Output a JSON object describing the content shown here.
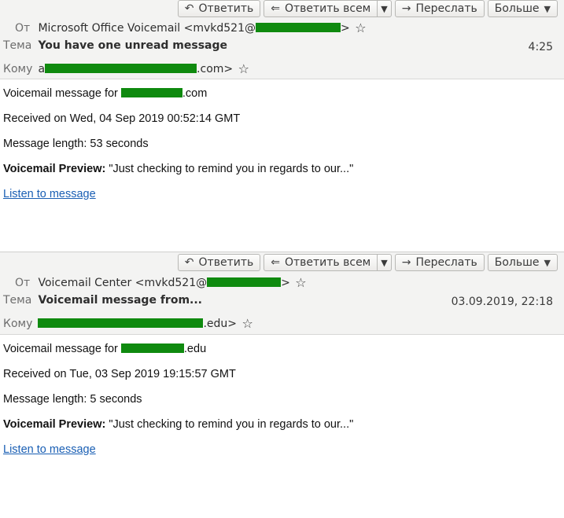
{
  "toolbar": {
    "reply_label": "Ответить",
    "reply_all_label": "Ответить всем",
    "forward_label": "Переслать",
    "more_label": "Больше"
  },
  "labels": {
    "from": "От",
    "subject": "Тема",
    "to": "Кому"
  },
  "emails": [
    {
      "from_text": "Microsoft Office Voicemail <mvkd521@",
      "from_suffix": ">",
      "subject": "You have one unread message",
      "date": "4:25",
      "to_prefix": "a",
      "to_suffix": ".com>",
      "body": {
        "line1_prefix": "Voicemail message for ",
        "line1_suffix": ".com",
        "received": "Received on Wed, 04 Sep 2019 00:52:14 GMT",
        "length": "Message length: 53 seconds",
        "preview_label": "Voicemail Preview:",
        "preview_text": " \"Just checking to remind you in regards to our...\"",
        "link": "Listen to message"
      }
    },
    {
      "from_text": "Voicemail Center <mvkd521@",
      "from_suffix": ">",
      "subject": "Voicemail message from...",
      "date": "03.09.2019, 22:18",
      "to_prefix": "",
      "to_suffix": ".edu>",
      "body": {
        "line1_prefix": "Voicemail message for ",
        "line1_suffix": ".edu",
        "received": "Received on Tue, 03 Sep 2019 19:15:57 GMT",
        "length": "Message length: 5 seconds",
        "preview_label": "Voicemail Preview:",
        "preview_text": " \"Just checking to remind you in regards to our...\"",
        "link": "Listen to message"
      }
    }
  ]
}
